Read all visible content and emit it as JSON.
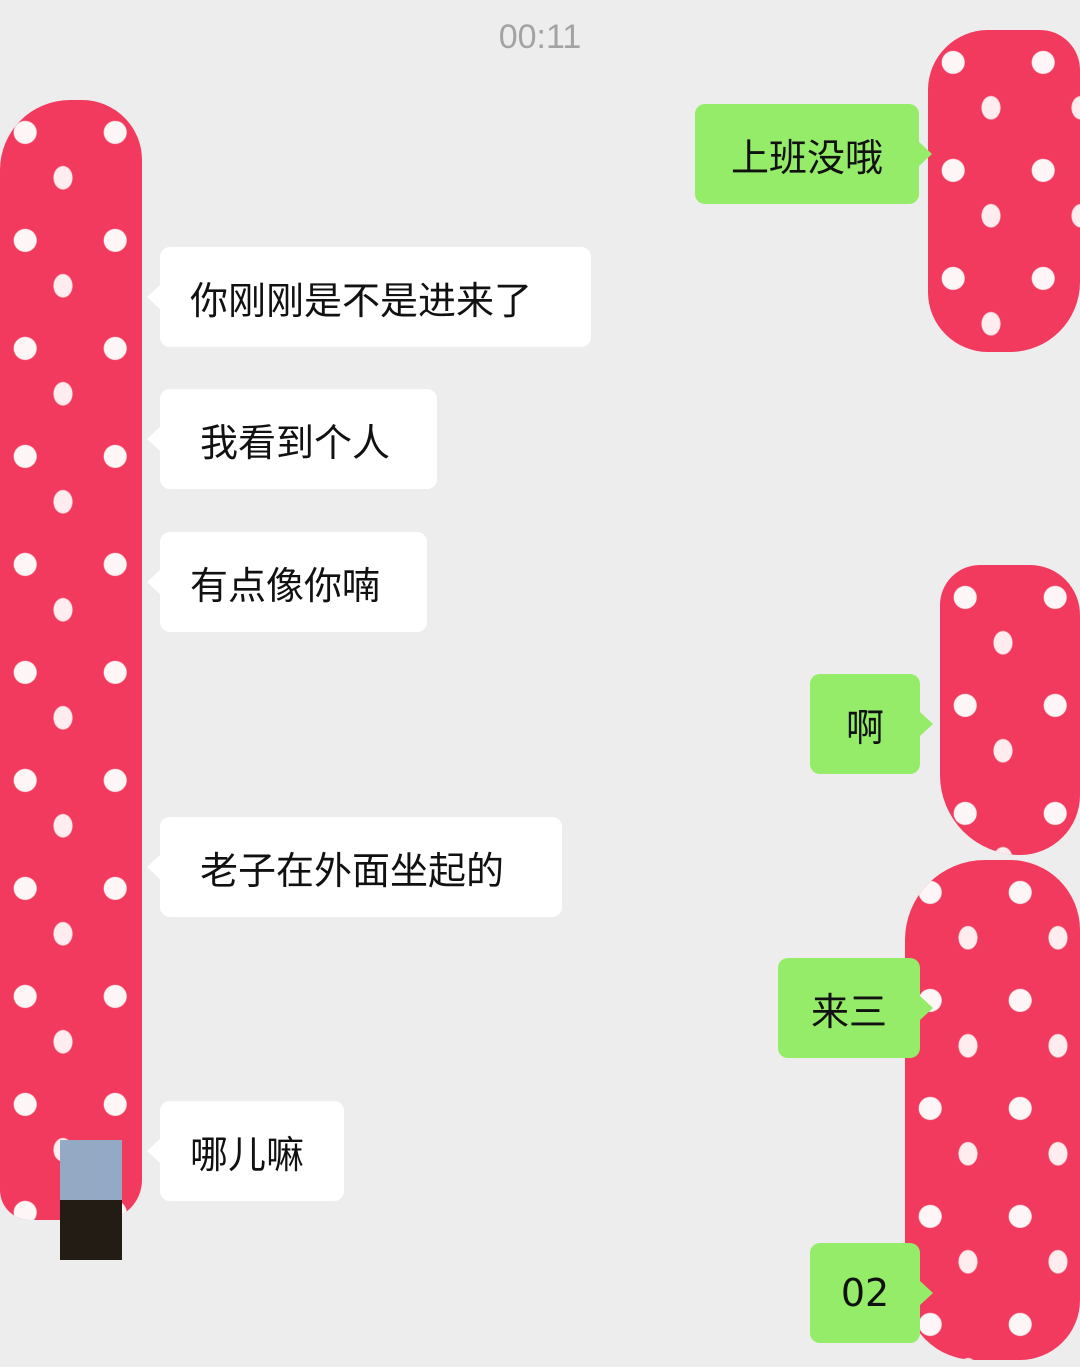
{
  "chat": {
    "timestamp": "00:11",
    "messages": [
      {
        "side": "out",
        "text": "上班没哦"
      },
      {
        "side": "in",
        "text": "你刚刚是不是进来了"
      },
      {
        "side": "in",
        "text": "我看到个人"
      },
      {
        "side": "in",
        "text": "有点像你喃"
      },
      {
        "side": "out",
        "text": "啊"
      },
      {
        "side": "in",
        "text": "老子在外面坐起的"
      },
      {
        "side": "out",
        "text": "来三"
      },
      {
        "side": "in",
        "text": "哪儿嘛"
      },
      {
        "side": "out",
        "text": "02"
      }
    ]
  },
  "colors": {
    "background": "#ededed",
    "incoming_bubble": "#ffffff",
    "outgoing_bubble": "#95ec69",
    "redaction": "#f2395e",
    "timestamp_text": "#a3a3a3"
  }
}
